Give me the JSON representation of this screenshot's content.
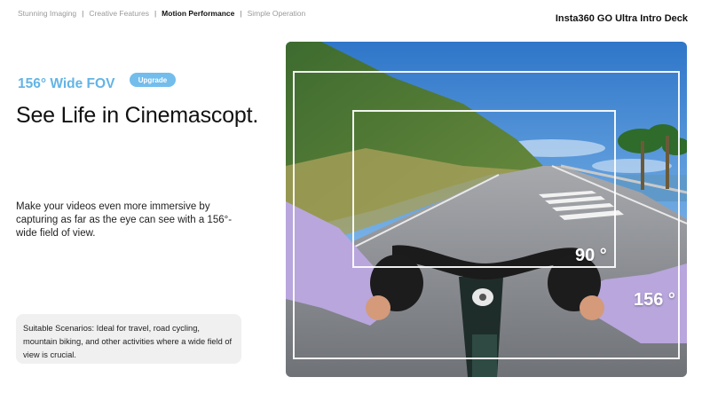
{
  "nav": {
    "items": [
      {
        "label": "Stunning Imaging",
        "active": false
      },
      {
        "label": "Creative Features",
        "active": false
      },
      {
        "label": "Motion Performance",
        "active": true
      },
      {
        "label": "Simple Operation",
        "active": false
      }
    ],
    "separator": "|"
  },
  "deck_title": "Insta360 GO Ultra Intro Deck",
  "hero": {
    "fov_label": "156° Wide FOV",
    "badge": "Upgrade",
    "headline": "See Life in Cinemascopt."
  },
  "description": "Make your videos even more immersive by capturing as far as the eye can see with a 156°-wide field of view.",
  "scenario": "Suitable Scenarios: Ideal for travel, road cycling, mountain biking, and other activities where a wide field of view is crucial.",
  "photo": {
    "inner_fov_label": "90 °",
    "outer_fov_label": "156 °"
  },
  "colors": {
    "accent": "#63b4e6",
    "badge": "#73bdec",
    "jersey": "#b8a6dd"
  }
}
